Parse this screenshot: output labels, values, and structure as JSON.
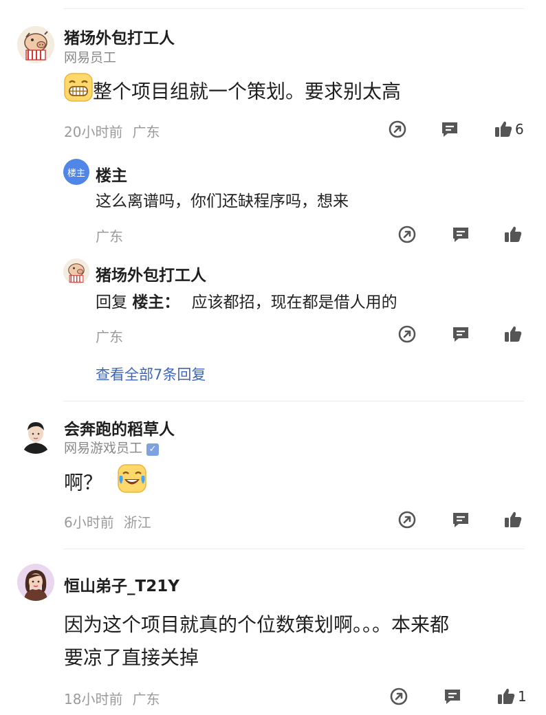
{
  "comments": [
    {
      "user": "猪场外包打工人",
      "title": "网易员工",
      "text": "整个项目组就一个策划。要求别太高",
      "time": "20小时前",
      "location": "广东",
      "likes": "6",
      "replies": [
        {
          "user": "楼主",
          "avatar_label": "楼主",
          "text": "这么离谱吗，你们还缺程序吗，想来",
          "location": "广东"
        },
        {
          "user": "猪场外包打工人",
          "reply_prefix": "回复",
          "reply_to": "楼主：",
          "text": "应该都招，现在都是借人用的",
          "location": "广东"
        }
      ],
      "view_all": "查看全部7条回复"
    },
    {
      "user": "会奔跑的稻草人",
      "title": "网易游戏员工",
      "text": "啊？",
      "time": "6小时前",
      "location": "浙江",
      "likes": ""
    },
    {
      "user": "恒山弟子_T21Y",
      "text_line1": "因为这个项目就真的个位数策划啊。。。本来都",
      "text_line2": "要凉了直接关掉",
      "time": "18小时前",
      "location": "广东",
      "likes": "1"
    }
  ],
  "icons": {
    "share": "share-icon",
    "comment": "comment-icon",
    "like": "thumbs-up-icon",
    "verified": "verified-badge-icon"
  },
  "colors": {
    "link": "#3d66b8",
    "meta": "#9a9a9a",
    "avatar_badge": "#4f86e8"
  }
}
